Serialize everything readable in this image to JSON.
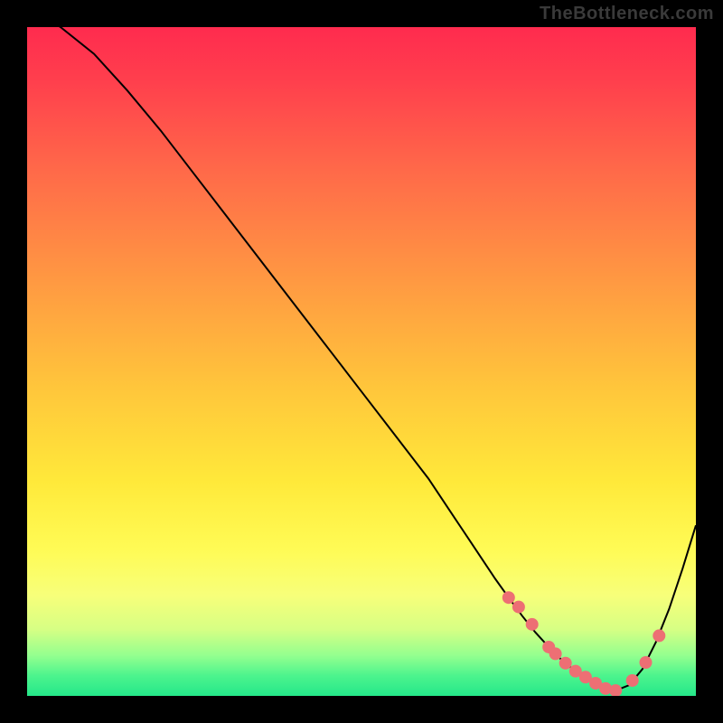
{
  "watermark": "TheBottleneck.com",
  "chart_data": {
    "type": "line",
    "title": "",
    "xlabel": "",
    "ylabel": "",
    "xlim": [
      0,
      100
    ],
    "ylim": [
      0,
      100
    ],
    "series": [
      {
        "name": "curve",
        "x": [
          0,
          5,
          10,
          15,
          20,
          25,
          30,
          35,
          40,
          45,
          50,
          55,
          60,
          62,
          64,
          66,
          68,
          70,
          72,
          74,
          76,
          78,
          80,
          82,
          84,
          86,
          88,
          90,
          92,
          94,
          96,
          98,
          100
        ],
        "y": [
          103,
          100,
          96,
          90.5,
          84.5,
          78,
          71.5,
          65,
          58.5,
          52,
          45.5,
          39,
          32.5,
          29.5,
          26.5,
          23.5,
          20.5,
          17.5,
          14.7,
          12.0,
          9.5,
          7.3,
          5.3,
          3.7,
          2.4,
          1.4,
          0.8,
          1.6,
          4.0,
          8.0,
          13.0,
          19.0,
          25.5
        ]
      }
    ],
    "markers": {
      "name": "highlight-dots",
      "color": "#ed6f74",
      "points": [
        {
          "x": 72,
          "y": 14.7
        },
        {
          "x": 73.5,
          "y": 13.3
        },
        {
          "x": 75.5,
          "y": 10.7
        },
        {
          "x": 78,
          "y": 7.3
        },
        {
          "x": 79,
          "y": 6.3
        },
        {
          "x": 80.5,
          "y": 4.9
        },
        {
          "x": 82,
          "y": 3.7
        },
        {
          "x": 83.5,
          "y": 2.8
        },
        {
          "x": 85,
          "y": 1.9
        },
        {
          "x": 86.5,
          "y": 1.1
        },
        {
          "x": 88,
          "y": 0.8
        },
        {
          "x": 90.5,
          "y": 2.3
        },
        {
          "x": 92.5,
          "y": 5.0
        },
        {
          "x": 94.5,
          "y": 9.0
        }
      ]
    },
    "gradient_stops": [
      {
        "offset": 0.0,
        "color": "#ff2b4e"
      },
      {
        "offset": 0.5,
        "color": "#ffd23a"
      },
      {
        "offset": 0.85,
        "color": "#fbff60"
      },
      {
        "offset": 1.0,
        "color": "#25e78a"
      }
    ]
  }
}
